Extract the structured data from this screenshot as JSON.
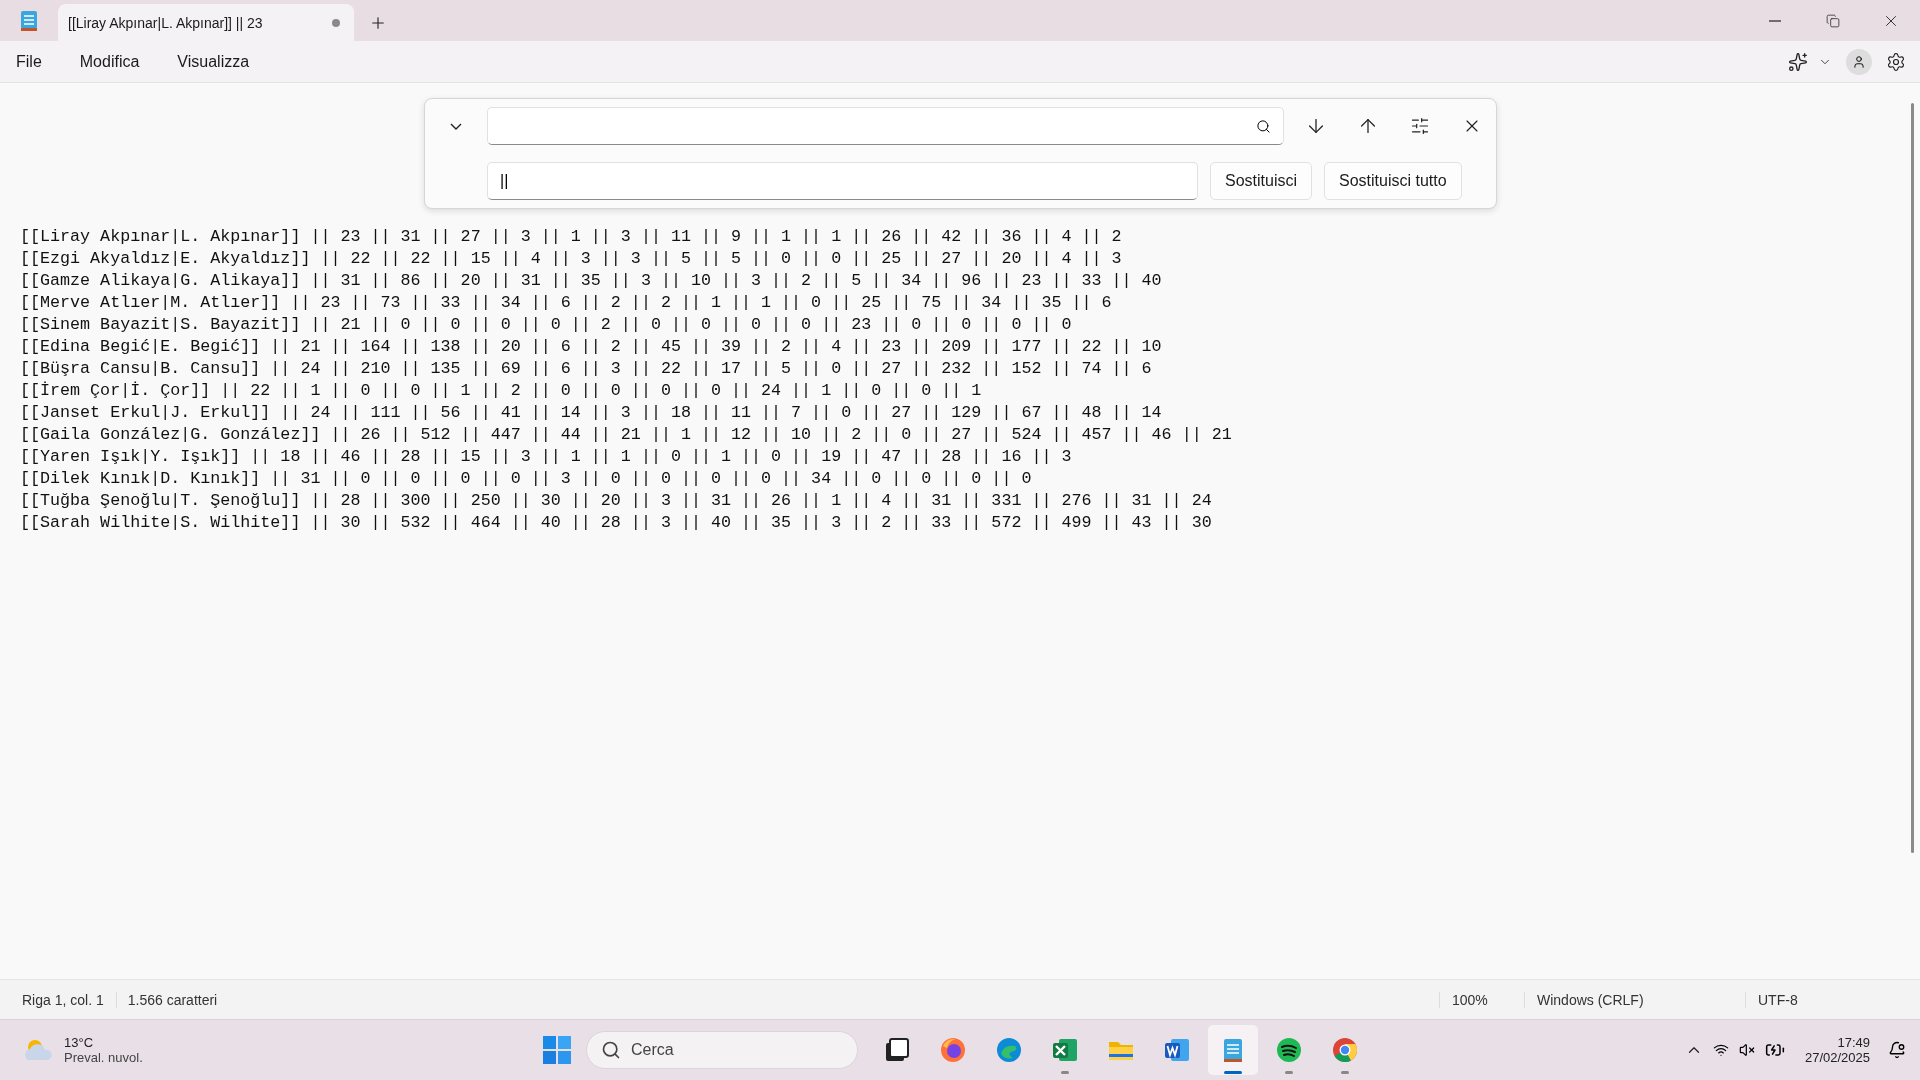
{
  "tab": {
    "title": "[[Liray Akpınar|L. Akpınar]] || 23",
    "unsaved": true
  },
  "menu": [
    "File",
    "Modifica",
    "Visualizza"
  ],
  "find": {
    "replace_value": "||",
    "buttons": [
      "Sostituisci",
      "Sostituisci tutto"
    ]
  },
  "lines": [
    "[[Liray Akpınar|L. Akpınar]] || 23 || 31 || 27 || 3 || 1 || 3 || 11 || 9 || 1 || 1 || 26 || 42 || 36 || 4 || 2",
    "[[Ezgi Akyaldız|E. Akyaldız]] || 22 || 22 || 15 || 4 || 3 || 3 || 5 || 5 || 0 || 0 || 25 || 27 || 20 || 4 || 3",
    "[[Gamze Alikaya|G. Alikaya]] || 31 || 86 || 20 || 31 || 35 || 3 || 10 || 3 || 2 || 5 || 34 || 96 || 23 || 33 || 40",
    "[[Merve Atlıer|M. Atlıer]] || 23 || 73 || 33 || 34 || 6 || 2 || 2 || 1 || 1 || 0 || 25 || 75 || 34 || 35 || 6",
    "[[Sinem Bayazit|S. Bayazit]] || 21 || 0 || 0 || 0 || 0 || 2 || 0 || 0 || 0 || 0 || 23 || 0 || 0 || 0 || 0",
    "[[Edina Begić|E. Begić]] || 21 || 164 || 138 || 20 || 6 || 2 || 45 || 39 || 2 || 4 || 23 || 209 || 177 || 22 || 10",
    "[[Büşra Cansu|B. Cansu]] || 24 || 210 || 135 || 69 || 6 || 3 || 22 || 17 || 5 || 0 || 27 || 232 || 152 || 74 || 6",
    "[[İrem Çor|İ. Çor]] || 22 || 1 || 0 || 0 || 1 || 2 || 0 || 0 || 0 || 0 || 24 || 1 || 0 || 0 || 1",
    "[[Janset Erkul|J. Erkul]] || 24 || 111 || 56 || 41 || 14 || 3 || 18 || 11 || 7 || 0 || 27 || 129 || 67 || 48 || 14",
    "[[Gaila González|G. González]] || 26 || 512 || 447 || 44 || 21 || 1 || 12 || 10 || 2 || 0 || 27 || 524 || 457 || 46 || 21",
    "[[Yaren Işık|Y. Işık]] || 18 || 46 || 28 || 15 || 3 || 1 || 1 || 0 || 1 || 0 || 19 || 47 || 28 || 16 || 3",
    "[[Dilek Kınık|D. Kınık]] || 31 || 0 || 0 || 0 || 0 || 3 || 0 || 0 || 0 || 0 || 34 || 0 || 0 || 0 || 0",
    "[[Tuğba Şenoğlu|T. Şenoğlu]] || 28 || 300 || 250 || 30 || 20 || 3 || 31 || 26 || 1 || 4 || 31 || 331 || 276 || 31 || 24",
    "[[Sarah Wilhite|S. Wilhite]] || 30 || 532 || 464 || 40 || 28 || 3 || 40 || 35 || 3 || 2 || 33 || 572 || 499 || 43 || 30"
  ],
  "status_bar": {
    "position": "Riga 1, col. 1",
    "characters": "1.566 caratteri",
    "zoom": "100%",
    "line_ending": "Windows (CRLF)",
    "encoding": "UTF-8"
  },
  "taskbar": {
    "weather": {
      "temperature": "13°C",
      "condition": "Preval. nuvol."
    },
    "search_placeholder": "Cerca",
    "apps": [
      {
        "kind": "taskview",
        "running": false,
        "selected": false
      },
      {
        "kind": "firefox",
        "running": false,
        "selected": false
      },
      {
        "kind": "edge",
        "running": false,
        "selected": false
      },
      {
        "kind": "excel",
        "running": true,
        "selected": false
      },
      {
        "kind": "explorer",
        "running": false,
        "selected": false
      },
      {
        "kind": "word",
        "running": false,
        "selected": false
      },
      {
        "kind": "notepad",
        "running": true,
        "selected": true
      },
      {
        "kind": "spotify",
        "running": true,
        "selected": false
      },
      {
        "kind": "chrome",
        "running": true,
        "selected": false
      }
    ],
    "time": "17:49",
    "date": "27/02/2025"
  }
}
